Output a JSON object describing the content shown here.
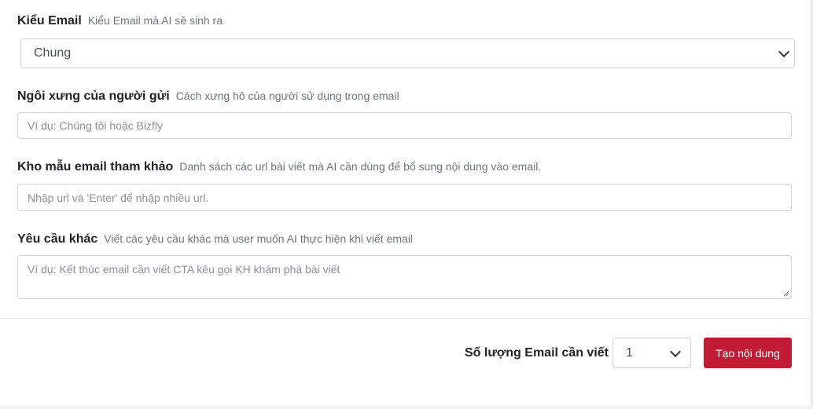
{
  "email_type": {
    "label": "Kiểu Email",
    "hint": "Kiểu Email mà AI sẽ sinh ra",
    "selected": "Chung"
  },
  "sender_pronoun": {
    "label": "Ngôi xưng của người gửi",
    "hint": "Cách xưng hô của người sử dụng trong email",
    "placeholder": "Ví dụ: Chúng tôi hoặc Bizfly"
  },
  "reference_templates": {
    "label": "Kho mẫu email tham khảo",
    "hint": "Danh sách các url bài viết mà AI cần dùng để bổ sung nội dung vào email.",
    "placeholder": "Nhập url và 'Enter' để nhập nhiều url."
  },
  "other_requirements": {
    "label": "Yêu cầu khác",
    "hint": "Viết các yêu cầu khác mà user muốn AI thực hiện khi viết email",
    "placeholder": "Ví dụ: Kết thúc email cần viết CTA kêu gọi KH khám phá bài viết"
  },
  "footer": {
    "count_label": "Số lượng Email cần viết",
    "count_selected": "1",
    "generate_button": "Tạo nội dung"
  },
  "colors": {
    "primary": "#c21b35",
    "border": "#ced4da",
    "hint": "#6c757d"
  }
}
